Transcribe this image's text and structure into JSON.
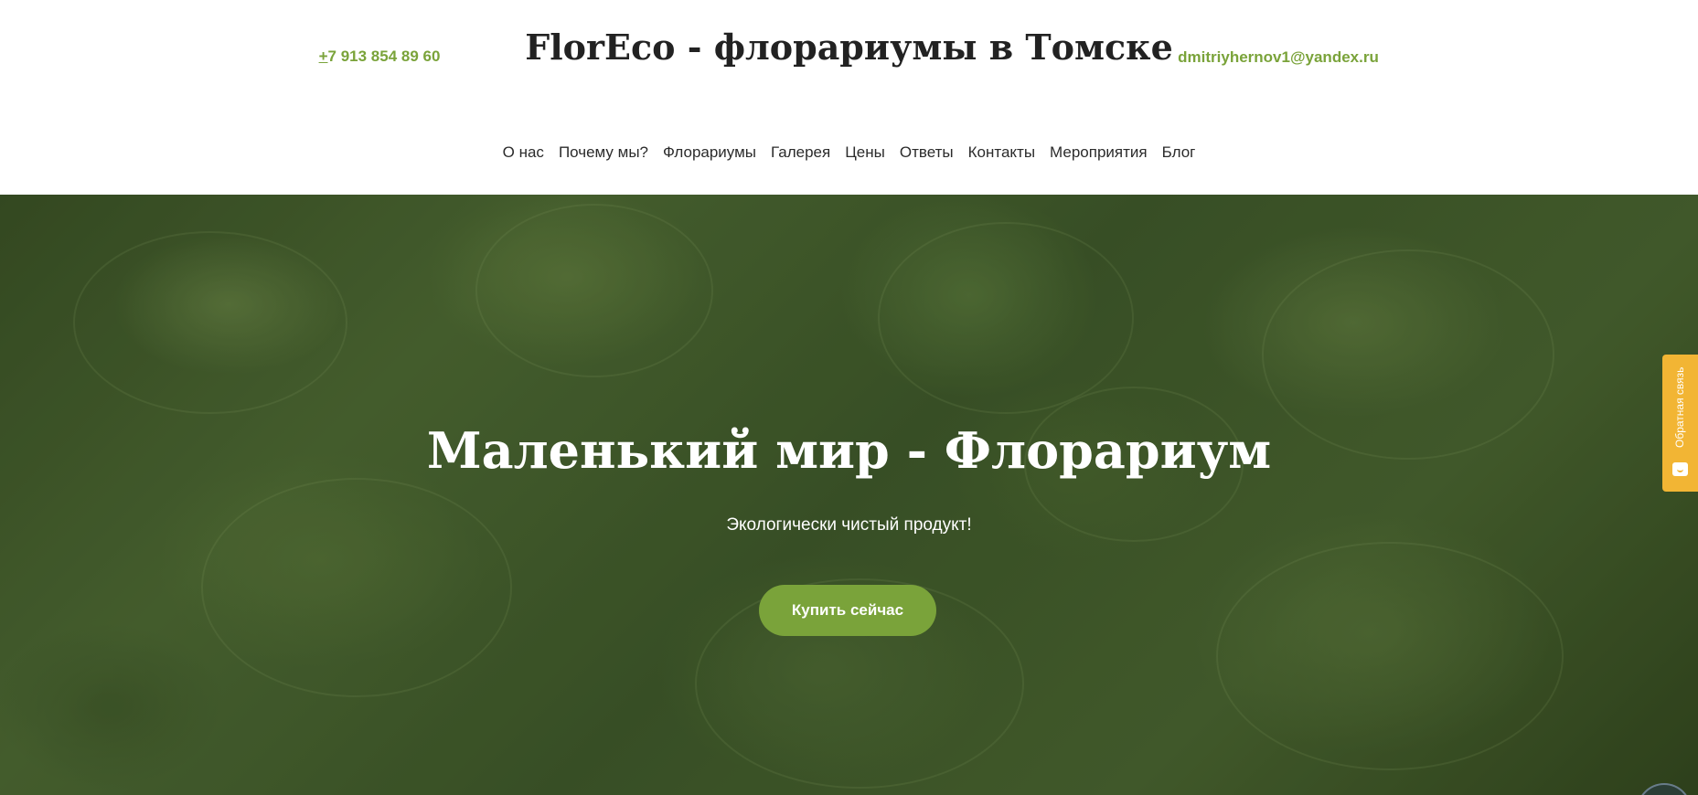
{
  "header": {
    "phone": "+7 913 854 89 60",
    "title": "FlorEco - флорариумы в Томске",
    "email": "dmitriyhernov1@yandex.ru"
  },
  "nav": {
    "items": [
      {
        "label": "О нас"
      },
      {
        "label": "Почему мы?"
      },
      {
        "label": "Флорариумы"
      },
      {
        "label": "Галерея"
      },
      {
        "label": "Цены"
      },
      {
        "label": "Ответы"
      },
      {
        "label": "Контакты"
      },
      {
        "label": "Мероприятия"
      },
      {
        "label": "Блог"
      }
    ]
  },
  "hero": {
    "title": "Маленький мир - Флорариум",
    "subtitle": "Экологически чистый продукт!",
    "button_label": "Купить сейчас"
  },
  "feedback": {
    "label": "Обратная связь",
    "icon": "chat-smile-icon"
  },
  "colors": {
    "accent": "#7aa33a",
    "feedback": "#f2b534",
    "title_text": "#222222"
  }
}
